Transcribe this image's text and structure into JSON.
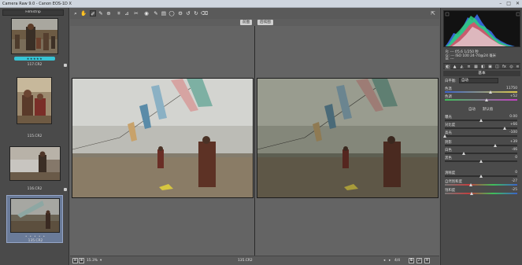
{
  "app": {
    "title": "Camera Raw 9.0  -  Canon EOS-1D X",
    "window_buttons": [
      "–",
      "□",
      "✕"
    ]
  },
  "filmstrip": {
    "header": "Filmstrip",
    "thumbs": [
      {
        "label": "117.CR2",
        "rating_marks": "★★★★★"
      },
      {
        "label": "115.CR2"
      },
      {
        "label": "116.CR2"
      },
      {
        "label": "135.CR2",
        "stars": "• • • • •"
      }
    ]
  },
  "toolbar": {
    "tools": [
      "search-icon",
      "hand-icon",
      "white-balance-icon",
      "color-sampler-icon",
      "target-adjust-icon",
      "crop-icon",
      "straighten-icon",
      "spot-removal-icon",
      "red-eye-icon",
      "adjustment-brush-icon",
      "graduated-filter-icon",
      "radial-filter-icon",
      "preferences-icon",
      "rotate-left-icon",
      "rotate-right-icon",
      "trash-icon"
    ],
    "tool_glyphs": [
      "⌕",
      "✋",
      "✐",
      "✎",
      "⊕",
      "⌗",
      "⊿",
      "✂",
      "◉",
      "✎",
      "▤",
      "◯",
      "⚙",
      "↺",
      "↻",
      "⌫"
    ],
    "right_icon": "⇱"
  },
  "views": {
    "before_label": "前图",
    "after_label": "后续图"
  },
  "bottom_bar": {
    "zoom_value": "15.3%",
    "center_label": "135.CR2",
    "page_count": "4/4",
    "left_glyphs": [
      "⊟",
      "⊞"
    ],
    "right_glyphs": [
      "◂",
      "▸",
      "⧉",
      "⇄",
      "⚙"
    ]
  },
  "right_panel": {
    "readout": [
      "R: ---   f/5.6   1/250 秒",
      "G: ---   ISO 100   24-70@24 毫米",
      "B: ---"
    ],
    "tab_glyphs": [
      "◐",
      "▲",
      "◭",
      "≡",
      "▦",
      "◧",
      "▣",
      "◫",
      "fx",
      "◎",
      "≋"
    ],
    "section_title": "基本",
    "white_balance": {
      "label": "白平衡:",
      "value": "自动"
    },
    "auto_label": "自动",
    "default_label": "默认值",
    "sliders": [
      {
        "label": "色温",
        "value": "11750",
        "position": 0.64
      },
      {
        "label": "色调",
        "value": "+52",
        "position": 0.58
      },
      {
        "label": "曝光",
        "value": "0.00",
        "position": 0.5
      },
      {
        "label": "对比度",
        "value": "+66",
        "position": 0.83
      },
      {
        "label": "高光",
        "value": "-100",
        "position": 0.0
      },
      {
        "label": "阴影",
        "value": "+39",
        "position": 0.7
      },
      {
        "label": "白色",
        "value": "-46",
        "position": 0.27
      },
      {
        "label": "黑色",
        "value": "0",
        "position": 0.5
      },
      {
        "label": "清晰度",
        "value": "0",
        "position": 0.5
      },
      {
        "label": "自然饱和度",
        "value": "-27",
        "position": 0.36
      },
      {
        "label": "饱和度",
        "value": "-25",
        "position": 0.38
      }
    ]
  }
}
